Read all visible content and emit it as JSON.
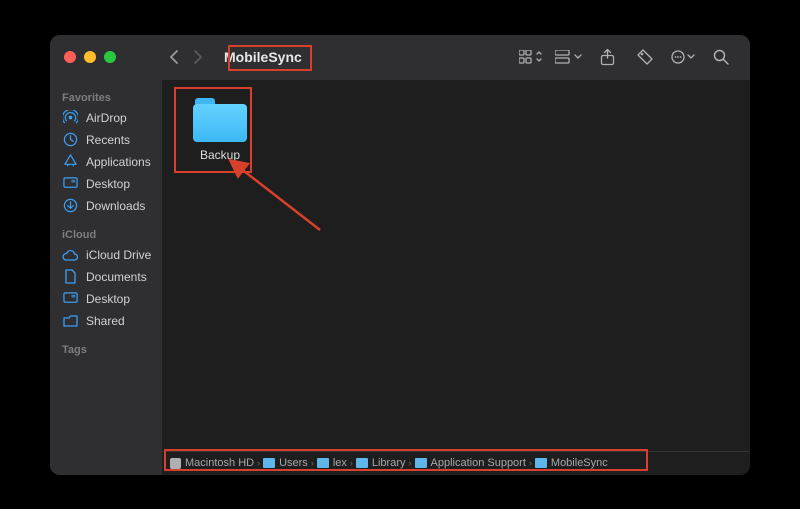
{
  "window": {
    "title": "MobileSync"
  },
  "sidebar": {
    "sections": [
      {
        "heading": "Favorites",
        "items": [
          {
            "icon": "airdrop",
            "label": "AirDrop"
          },
          {
            "icon": "recents",
            "label": "Recents"
          },
          {
            "icon": "applications",
            "label": "Applications"
          },
          {
            "icon": "desktop",
            "label": "Desktop"
          },
          {
            "icon": "downloads",
            "label": "Downloads"
          }
        ]
      },
      {
        "heading": "iCloud",
        "items": [
          {
            "icon": "icloud",
            "label": "iCloud Drive"
          },
          {
            "icon": "documents",
            "label": "Documents"
          },
          {
            "icon": "desktop",
            "label": "Desktop"
          },
          {
            "icon": "shared",
            "label": "Shared"
          }
        ]
      },
      {
        "heading": "Tags",
        "items": []
      }
    ]
  },
  "files": [
    {
      "name": "Backup",
      "type": "folder"
    }
  ],
  "path": [
    {
      "label": "Macintosh HD",
      "kind": "hd"
    },
    {
      "label": "Users",
      "kind": "folder"
    },
    {
      "label": "lex",
      "kind": "folder"
    },
    {
      "label": "Library",
      "kind": "folder"
    },
    {
      "label": "Application Support",
      "kind": "folder"
    },
    {
      "label": "MobileSync",
      "kind": "folder"
    }
  ],
  "colors": {
    "accent_folder": "#3cb8f4",
    "sidebar_icon": "#3a9ff5",
    "highlight": "#d9402b"
  }
}
